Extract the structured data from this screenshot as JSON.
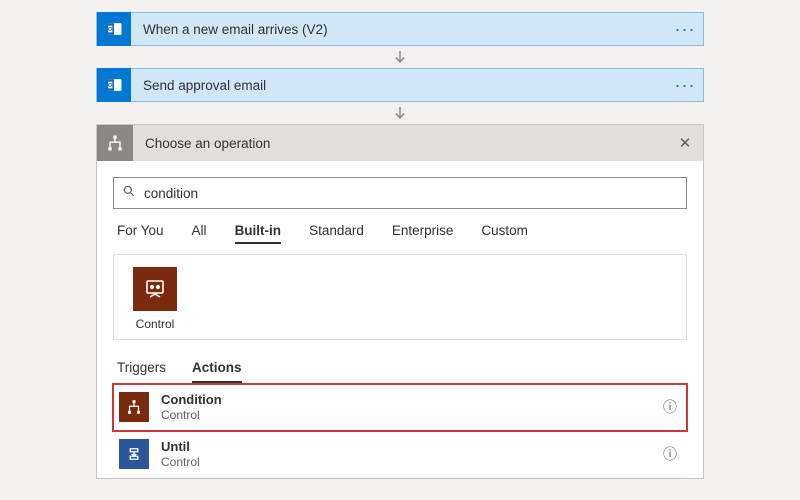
{
  "steps": [
    {
      "label": "When a new email arrives (V2)"
    },
    {
      "label": "Send approval email"
    }
  ],
  "panel": {
    "title": "Choose an operation",
    "search_value": "condition",
    "tabs": [
      "For You",
      "All",
      "Built-in",
      "Standard",
      "Enterprise",
      "Custom"
    ],
    "active_tab": "Built-in",
    "connector": {
      "label": "Control"
    },
    "subtabs": [
      "Triggers",
      "Actions"
    ],
    "active_subtab": "Actions",
    "actions": [
      {
        "name": "Condition",
        "sub": "Control",
        "icon": "brown",
        "highlight": true
      },
      {
        "name": "Until",
        "sub": "Control",
        "icon": "blue",
        "highlight": false
      }
    ]
  }
}
